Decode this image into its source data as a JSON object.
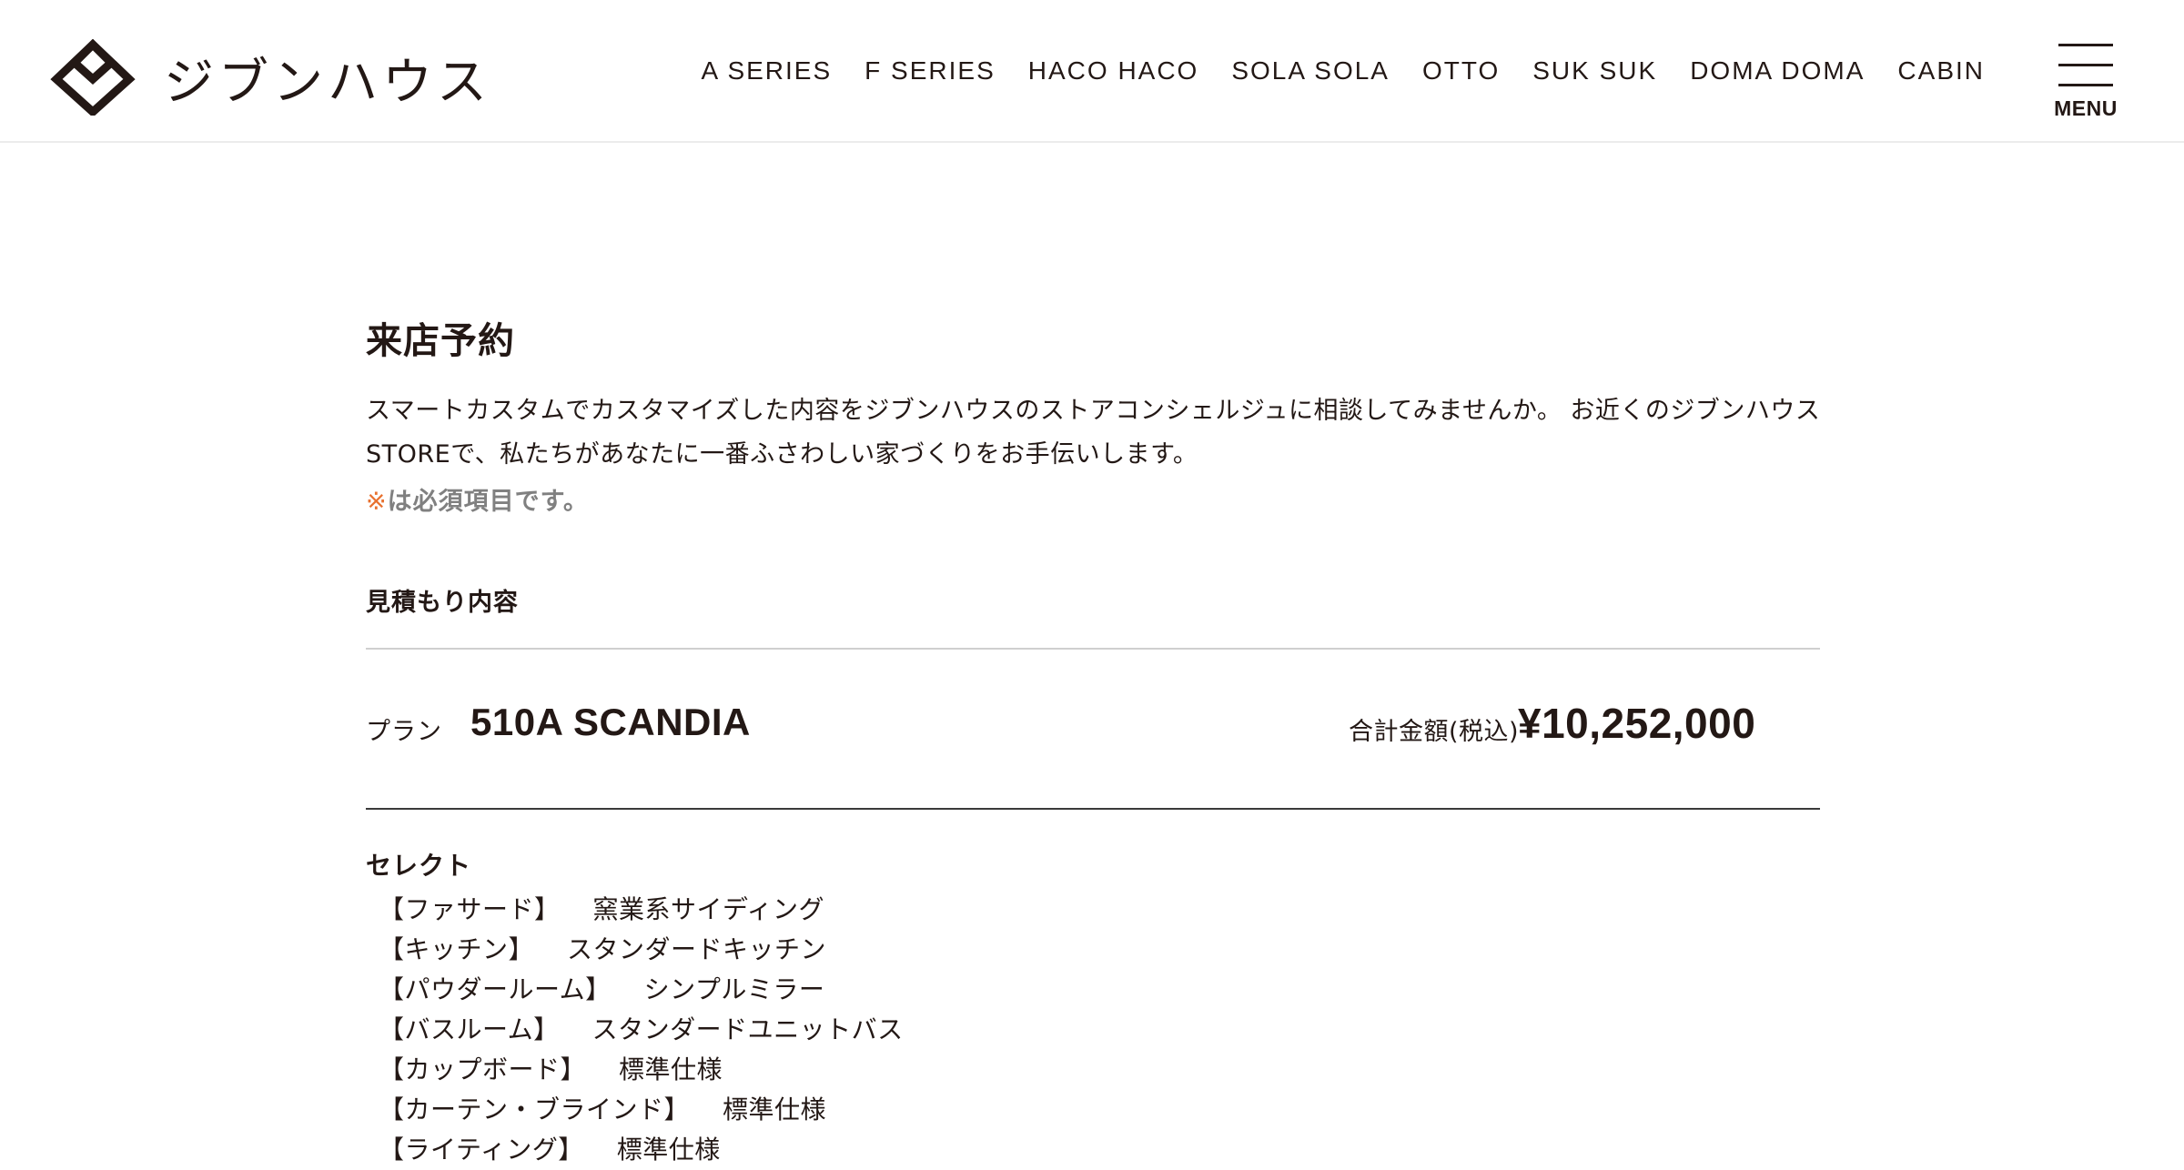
{
  "header": {
    "logo_text": "ジブンハウス",
    "nav": [
      "A SERIES",
      "F SERIES",
      "HACO HACO",
      "SOLA SOLA",
      "OTTO",
      "SUK SUK",
      "DOMA DOMA",
      "CABIN"
    ],
    "menu_label": "MENU"
  },
  "main": {
    "title": "来店予約",
    "intro": "スマートカスタムでカスタマイズした内容をジブンハウスのストアコンシェルジュに相談してみませんか。 お近くのジブンハウス STOREで、私たちがあなたに一番ふさわしい家づくりをお手伝いします。",
    "required_mark": "※",
    "required_text": "は必須項目です。",
    "estimate_label": "見積もり内容",
    "plan_label": "プラン",
    "plan_name": "510A SCANDIA",
    "total_label": "合計金額(税込)",
    "total_amount": "¥10,252,000",
    "select_title": "セレクト",
    "select_items": [
      {
        "category": "【ファサード】",
        "value": "窯業系サイディング"
      },
      {
        "category": "【キッチン】",
        "value": "スタンダードキッチン"
      },
      {
        "category": "【パウダールーム】",
        "value": "シンプルミラー"
      },
      {
        "category": "【バスルーム】",
        "value": "スタンダードユニットバス"
      },
      {
        "category": "【カップボード】",
        "value": "標準仕様"
      },
      {
        "category": "【カーテン・ブラインド】",
        "value": "標準仕様"
      },
      {
        "category": "【ライティング】",
        "value": "標準仕様"
      }
    ]
  },
  "colors": {
    "text": "#231815",
    "required_mark": "#e8712f",
    "muted": "#808080",
    "divider_light": "#cfcfcf",
    "divider_dark": "#3a3a3a"
  },
  "icons": {
    "logo": "interlocking-diamond-logo-icon",
    "menu": "hamburger-menu-icon"
  }
}
